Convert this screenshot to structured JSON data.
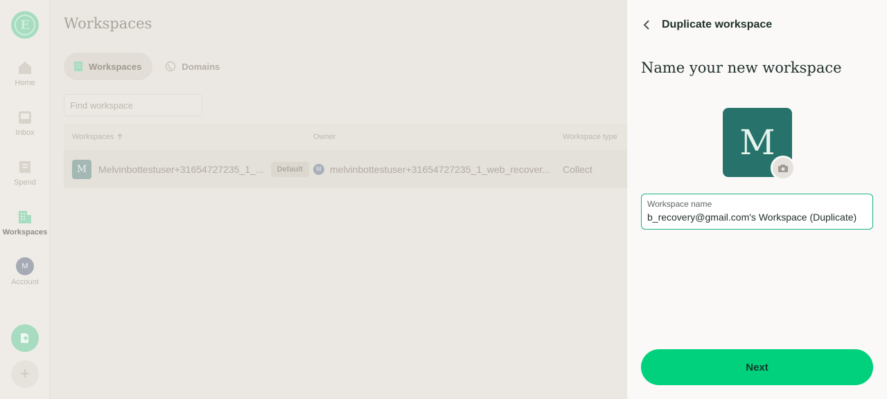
{
  "nav": {
    "items": [
      {
        "label": "Home",
        "icon": "home-icon"
      },
      {
        "label": "Inbox",
        "icon": "inbox-icon"
      },
      {
        "label": "Spend",
        "icon": "receipt-icon"
      },
      {
        "label": "Workspaces",
        "icon": "building-icon",
        "active": true
      },
      {
        "label": "Account",
        "icon": "avatar",
        "initial": "M"
      }
    ],
    "logo_letter": "E"
  },
  "main": {
    "title": "Workspaces",
    "tabs": [
      {
        "label": "Workspaces",
        "icon": "building-icon",
        "active": true
      },
      {
        "label": "Domains",
        "icon": "globe-icon"
      }
    ],
    "search_placeholder": "Find workspace",
    "columns": [
      "Workspaces",
      "Owner",
      "Workspace type"
    ],
    "rows": [
      {
        "avatar": "M",
        "name": "Melvinbottestuser+31654727235_1_...",
        "badge": "Default",
        "owner_initial": "M",
        "owner": "melvinbottestuser+31654727235_1_web_recover...",
        "type": "Collect"
      }
    ]
  },
  "panel": {
    "title": "Duplicate workspace",
    "heading": "Name your new workspace",
    "avatar_letter": "M",
    "field_label": "Workspace name",
    "field_value": "b_recovery@gmail.com's Workspace (Duplicate)",
    "next_label": "Next"
  },
  "colors": {
    "accent": "#01d17c",
    "avatar_bg": "#27736b",
    "field_border": "#17b383"
  }
}
